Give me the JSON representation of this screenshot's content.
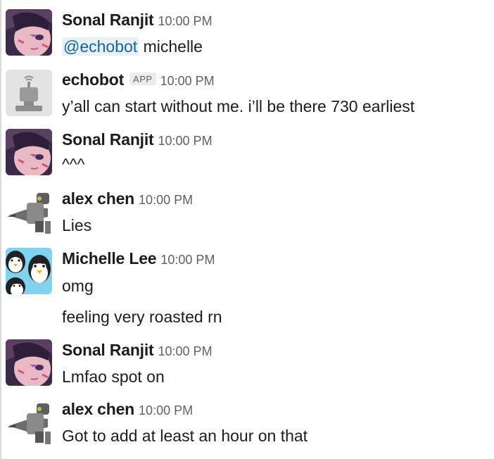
{
  "messages": [
    {
      "author": "Sonal Ranjit",
      "time": "10:00 PM",
      "mention": "@echobot",
      "text": " michelle"
    },
    {
      "author": "echobot",
      "badge": "APP",
      "time": "10:00 PM",
      "text": "y’all can start without me. i’ll be there 730 earliest"
    },
    {
      "author": "Sonal Ranjit",
      "time": "10:00 PM",
      "text": "^^^"
    },
    {
      "author": "alex chen",
      "time": "10:00 PM",
      "text": "Lies"
    },
    {
      "author": "Michelle Lee",
      "time": "10:00 PM",
      "text": "omg",
      "continuation": "feeling very roasted rn"
    },
    {
      "author": "Sonal Ranjit",
      "time": "10:00 PM",
      "text": "Lmfao spot on"
    },
    {
      "author": "alex chen",
      "time": "10:00 PM",
      "text": "Got to add at least an hour on that"
    }
  ],
  "avatars": {
    "sonal": "anime-character-avatar",
    "echobot": "robot-icon",
    "alex": "armored-character-avatar",
    "michelle": "penguin-avatar"
  }
}
